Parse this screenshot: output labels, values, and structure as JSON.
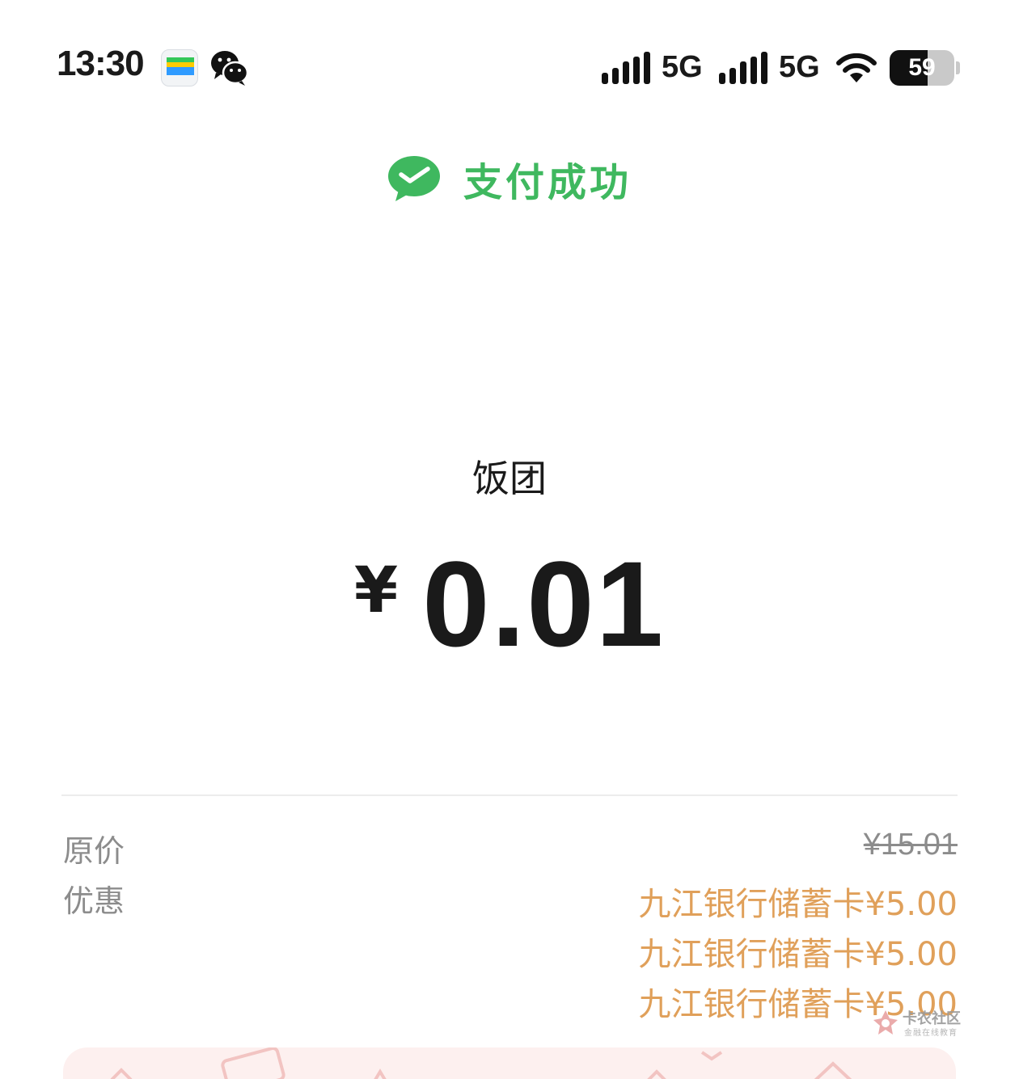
{
  "status_bar": {
    "time": "13:30",
    "signal_1_label": "5G",
    "signal_2_label": "5G",
    "battery_level": "59",
    "icons": [
      "wallet-app-icon",
      "wechat-icon",
      "signal-icon",
      "wifi-icon",
      "battery-icon"
    ]
  },
  "header": {
    "status_text": "支付成功",
    "icon": "wechat-pay-icon",
    "accent_color": "#3fb85f"
  },
  "payment": {
    "merchant": "饭团",
    "currency_symbol": "¥",
    "amount": "0.01"
  },
  "details": {
    "original_price_label": "原价",
    "original_price": "¥15.01",
    "discount_label": "优惠",
    "discounts": [
      "九江银行储蓄卡¥5.00",
      "九江银行储蓄卡¥5.00",
      "九江银行储蓄卡¥5.00"
    ],
    "discount_color": "#e0a05a"
  },
  "watermark": {
    "title": "卡农社区",
    "subtitle": "金融在线教育"
  }
}
